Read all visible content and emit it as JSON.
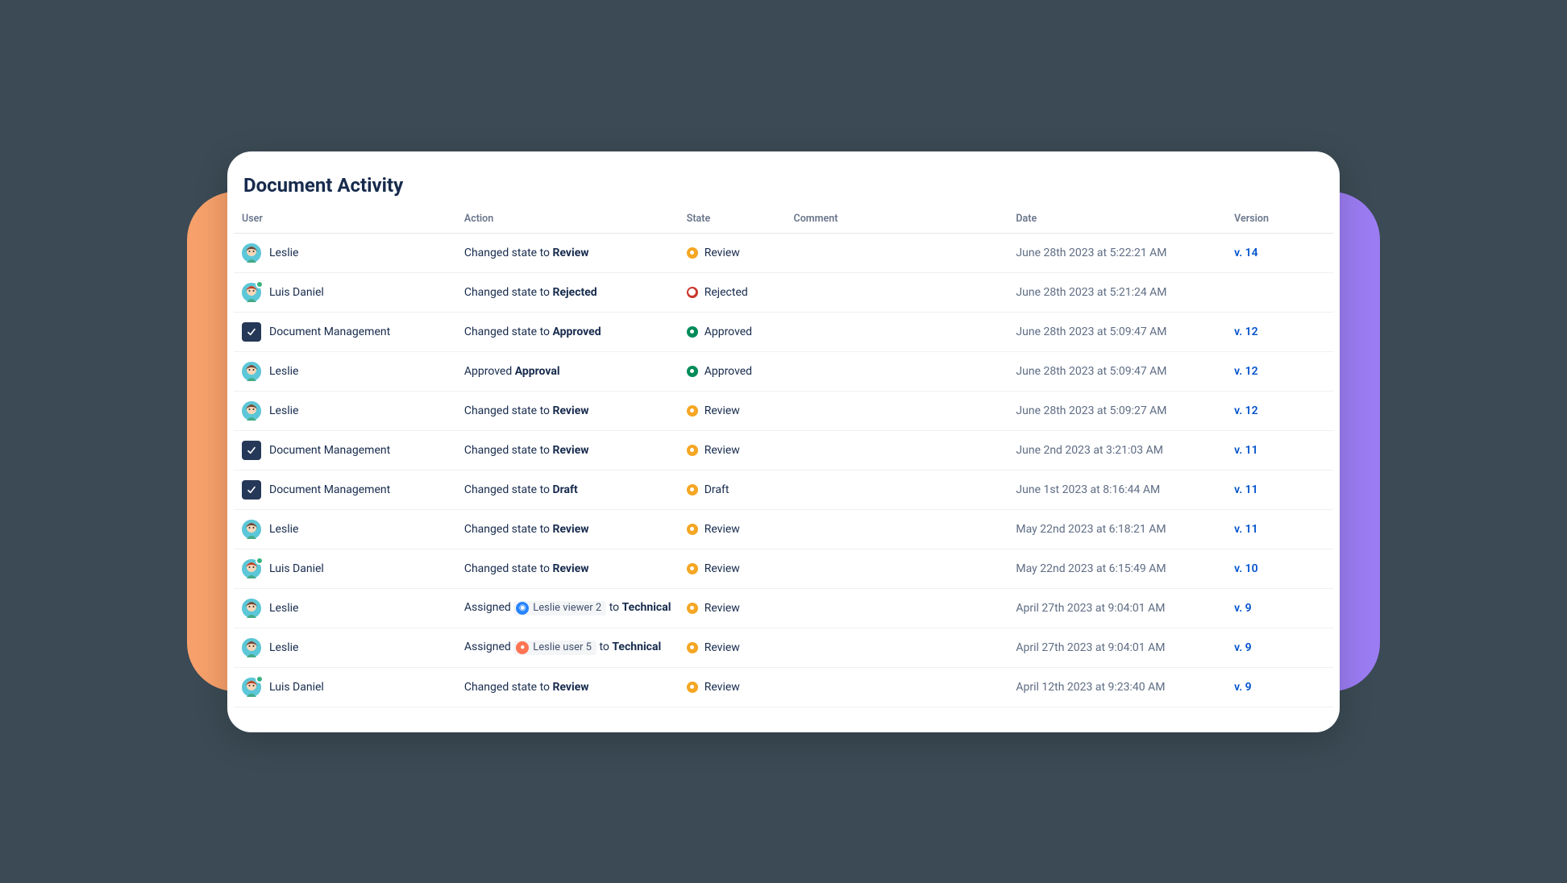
{
  "title": "Document Activity",
  "columns": {
    "user": "User",
    "action": "Action",
    "state": "State",
    "comment": "Comment",
    "date": "Date",
    "version": "Version"
  },
  "labels": {
    "changed_state_prefix": "Changed state to ",
    "approved_prefix": "Approved ",
    "assigned_prefix": "Assigned ",
    "assigned_to": " to "
  },
  "rows": [
    {
      "user": "Leslie",
      "avatar": "leslie",
      "online": false,
      "action_kind": "state",
      "target_state": "Review",
      "state": "Review",
      "state_color": "review",
      "date": "June 28th 2023 at 5:22:21 AM",
      "version": "v. 14"
    },
    {
      "user": "Luis Daniel",
      "avatar": "luis",
      "online": true,
      "action_kind": "state",
      "target_state": "Rejected",
      "state": "Rejected",
      "state_color": "rejected",
      "date": "June 28th 2023 at 5:21:24 AM",
      "version": ""
    },
    {
      "user": "Document Management",
      "avatar": "app",
      "online": false,
      "action_kind": "state",
      "target_state": "Approved",
      "state": "Approved",
      "state_color": "approved",
      "date": "June 28th 2023 at 5:09:47 AM",
      "version": "v. 12"
    },
    {
      "user": "Leslie",
      "avatar": "leslie",
      "online": false,
      "action_kind": "approved",
      "target_state": "Approval",
      "state": "Approved",
      "state_color": "approved",
      "date": "June 28th 2023 at 5:09:47 AM",
      "version": "v. 12"
    },
    {
      "user": "Leslie",
      "avatar": "leslie",
      "online": false,
      "action_kind": "state",
      "target_state": "Review",
      "state": "Review",
      "state_color": "review",
      "date": "June 28th 2023 at 5:09:27 AM",
      "version": "v. 12"
    },
    {
      "user": "Document Management",
      "avatar": "app",
      "online": false,
      "action_kind": "state",
      "target_state": "Review",
      "state": "Review",
      "state_color": "review",
      "date": "June 2nd 2023 at 3:21:03 AM",
      "version": "v. 11"
    },
    {
      "user": "Document Management",
      "avatar": "app",
      "online": false,
      "action_kind": "state",
      "target_state": "Draft",
      "state": "Draft",
      "state_color": "draft",
      "date": "June 1st 2023 at 8:16:44 AM",
      "version": "v. 11"
    },
    {
      "user": "Leslie",
      "avatar": "leslie",
      "online": false,
      "action_kind": "state",
      "target_state": "Review",
      "state": "Review",
      "state_color": "review",
      "date": "May 22nd 2023 at 6:18:21 AM",
      "version": "v. 11"
    },
    {
      "user": "Luis Daniel",
      "avatar": "luis",
      "online": true,
      "action_kind": "state",
      "target_state": "Review",
      "state": "Review",
      "state_color": "review",
      "date": "May 22nd 2023 at 6:15:49 AM",
      "version": "v. 10"
    },
    {
      "user": "Leslie",
      "avatar": "leslie",
      "online": false,
      "action_kind": "assigned",
      "assignee": "Leslie viewer 2",
      "assignee_type": "viewer",
      "role": "Technical",
      "state": "Review",
      "state_color": "review",
      "date": "April 27th 2023 at 9:04:01 AM",
      "version": "v. 9"
    },
    {
      "user": "Leslie",
      "avatar": "leslie",
      "online": false,
      "action_kind": "assigned",
      "assignee": "Leslie user 5",
      "assignee_type": "user",
      "role": "Technical",
      "state": "Review",
      "state_color": "review",
      "date": "April 27th 2023 at 9:04:01 AM",
      "version": "v. 9"
    },
    {
      "user": "Luis Daniel",
      "avatar": "luis",
      "online": true,
      "action_kind": "state",
      "target_state": "Review",
      "state": "Review",
      "state_color": "review",
      "date": "April 12th 2023 at 9:23:40 AM",
      "version": "v. 9"
    }
  ]
}
